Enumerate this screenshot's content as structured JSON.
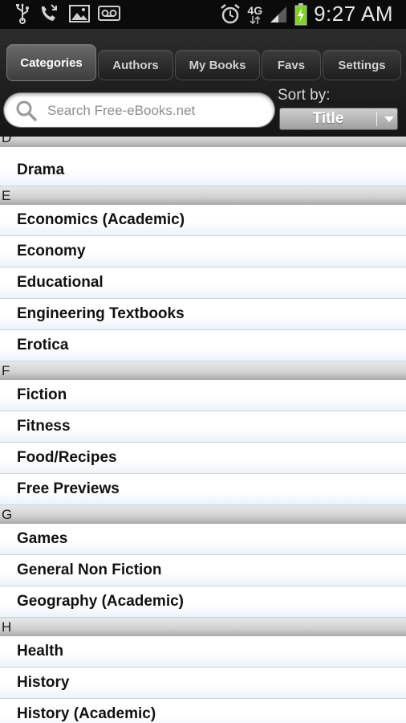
{
  "status_bar": {
    "time": "9:27 AM",
    "network": "4G",
    "icons": [
      "usb-icon",
      "missed-call-icon",
      "gallery-icon",
      "voicemail-icon",
      "alarm-icon",
      "network-4g-icon",
      "signal-icon",
      "battery-charging-icon"
    ]
  },
  "tabs": [
    {
      "label": "Categories",
      "active": true
    },
    {
      "label": "Authors",
      "active": false
    },
    {
      "label": "My Books",
      "active": false
    },
    {
      "label": "Favs",
      "active": false
    },
    {
      "label": "Settings",
      "active": false
    }
  ],
  "search": {
    "placeholder": "Search Free-eBooks.net",
    "value": ""
  },
  "sort": {
    "label": "Sort by:",
    "selected": "Title"
  },
  "sections": [
    {
      "letter": "D",
      "items": [
        "Drama"
      ]
    },
    {
      "letter": "E",
      "items": [
        "Economics (Academic)",
        "Economy",
        "Educational",
        "Engineering Textbooks",
        "Erotica"
      ]
    },
    {
      "letter": "F",
      "items": [
        "Fiction",
        "Fitness",
        "Food/Recipes",
        "Free Previews"
      ]
    },
    {
      "letter": "G",
      "items": [
        "Games",
        "General Non Fiction",
        "Geography (Academic)"
      ]
    },
    {
      "letter": "H",
      "items": [
        "Health",
        "History",
        "History (Academic)"
      ]
    }
  ],
  "colors": {
    "status_bar_bg": "#0b0b0b",
    "topbar_bg": "#1f1f1f",
    "battery_green": "#7ed321",
    "list_divider": "#c9d4df"
  }
}
